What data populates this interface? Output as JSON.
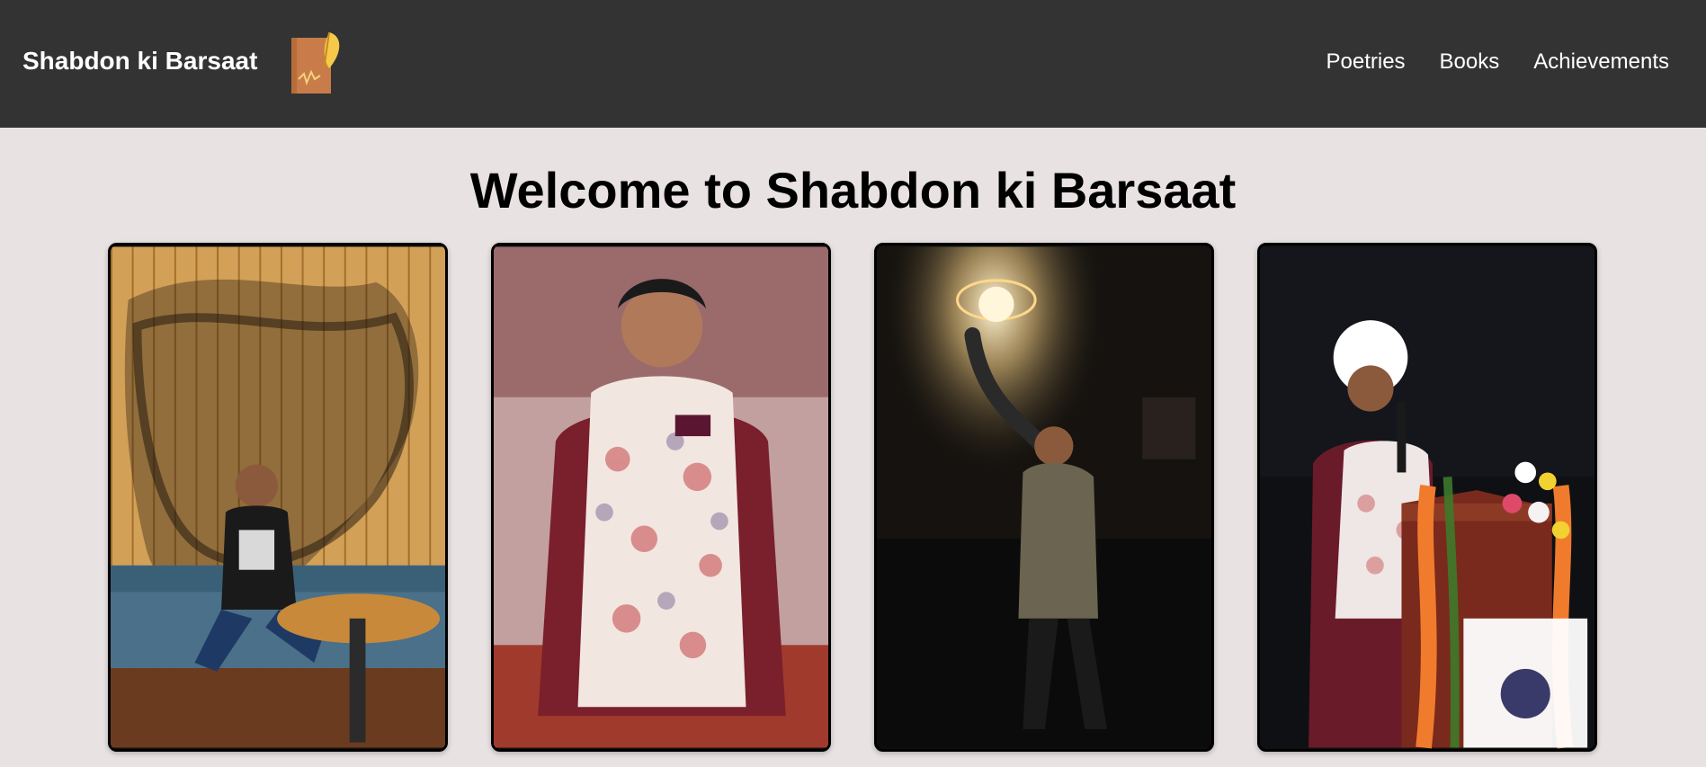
{
  "header": {
    "brand": "Shabdon ki Barsaat",
    "logo_icon": "feather-quill-book-icon",
    "nav": [
      {
        "label": "Poetries"
      },
      {
        "label": "Books"
      },
      {
        "label": "Achievements"
      }
    ]
  },
  "main": {
    "title": "Welcome to Shabdon ki Barsaat",
    "photos": [
      {
        "icon": "photo-cafe-seated-icon"
      },
      {
        "icon": "photo-portrait-floral-vest-icon"
      },
      {
        "icon": "photo-night-lamp-icon"
      },
      {
        "icon": "photo-podium-speech-icon"
      }
    ]
  },
  "colors": {
    "header_bg": "#333333",
    "page_bg": "#e8e2e2",
    "text_dark": "#000000",
    "text_light": "#ffffff"
  }
}
